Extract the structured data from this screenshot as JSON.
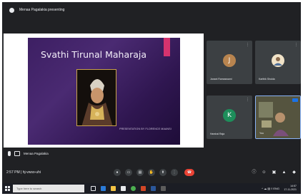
{
  "topbar": {
    "presenting_text": "Menaa Pagalakia presenting"
  },
  "slide": {
    "title": "Svathi Tirunal Maharaja",
    "caption": "PRESENTATION BY FLORENCE MAANSI",
    "colors": {
      "background": "#3d1f63",
      "accent": "#d5336e"
    }
  },
  "presenter": {
    "name": "Menaa Pagalakia"
  },
  "participants": [
    {
      "name": "Janani Ramaswami",
      "initial": "J",
      "avatar_color": "#b8844f",
      "more_icon": "more-vert-icon"
    },
    {
      "name": "Karthik Shukla",
      "initial": "",
      "avatar_color": "#f1e3c8",
      "more_icon": "more-vert-icon"
    },
    {
      "name": "Harshal Raja",
      "initial": "K",
      "avatar_color": "#1e8e5b",
      "more_icon": "more-vert-icon"
    },
    {
      "name": "You",
      "initial": "",
      "avatar_color": "#6f8f6a",
      "more_icon": "more-vert-icon"
    }
  ],
  "meeting": {
    "info": "2:57 PM  |  hj-vwso-uhi"
  },
  "controls": [
    {
      "name": "mic-button",
      "icon": "mic-icon",
      "glyph": "●"
    },
    {
      "name": "camera-button",
      "icon": "camera-icon",
      "glyph": "▭"
    },
    {
      "name": "captions-button",
      "icon": "captions-icon",
      "glyph": "▤"
    },
    {
      "name": "raise-hand-button",
      "icon": "hand-icon",
      "glyph": "✋"
    },
    {
      "name": "present-button",
      "icon": "present-icon",
      "glyph": "⬆"
    },
    {
      "name": "more-options-button",
      "icon": "more-vert-icon",
      "glyph": "⋮"
    },
    {
      "name": "end-call-button",
      "icon": "phone-end-icon",
      "glyph": "☎"
    }
  ],
  "right_controls": [
    {
      "name": "info-button",
      "icon": "info-icon",
      "glyph": "ⓘ"
    },
    {
      "name": "people-button",
      "icon": "people-icon",
      "glyph": "☺"
    },
    {
      "name": "chat-button",
      "icon": "chat-icon",
      "glyph": "▣"
    },
    {
      "name": "activities-button",
      "icon": "activities-icon",
      "glyph": "▲"
    },
    {
      "name": "host-controls-button",
      "icon": "lock-icon",
      "glyph": "◆"
    }
  ],
  "taskbar": {
    "search_placeholder": "Type here to search",
    "time": "14:57",
    "date": "17-11-2021",
    "tray_text": "^ ☁ ▤ ◊ ENG"
  }
}
